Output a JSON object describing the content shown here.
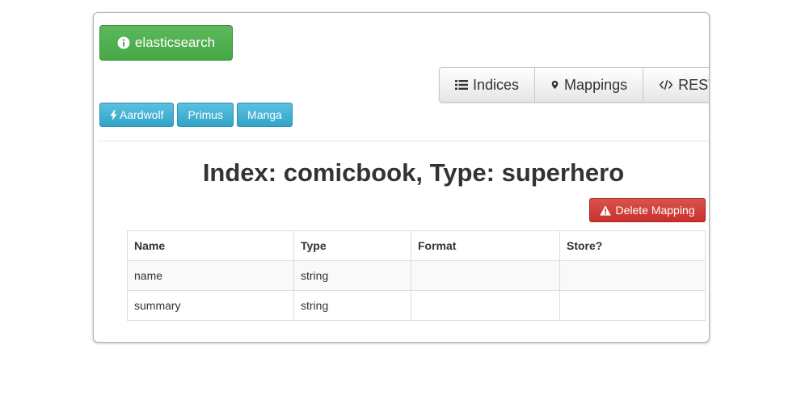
{
  "brand": {
    "label": "elasticsearch",
    "icon": "info-circle-icon",
    "color": "#5cb85c"
  },
  "tabs": [
    {
      "label": "Indices",
      "icon": "list-icon"
    },
    {
      "label": "Mappings",
      "icon": "map-marker-icon"
    },
    {
      "label": "REST",
      "icon": "code-icon"
    }
  ],
  "chips": [
    {
      "label": "Aardwolf",
      "icon": "bolt-icon"
    },
    {
      "label": "Primus"
    },
    {
      "label": "Manga"
    }
  ],
  "page_title": "Index: comicbook, Type: superhero",
  "delete_button": {
    "label": "Delete Mapping",
    "icon": "warning-icon",
    "color": "#d9534f"
  },
  "table": {
    "headers": [
      "Name",
      "Type",
      "Format",
      "Store?"
    ],
    "rows": [
      [
        "name",
        "string",
        "",
        ""
      ],
      [
        "summary",
        "string",
        "",
        ""
      ]
    ]
  }
}
